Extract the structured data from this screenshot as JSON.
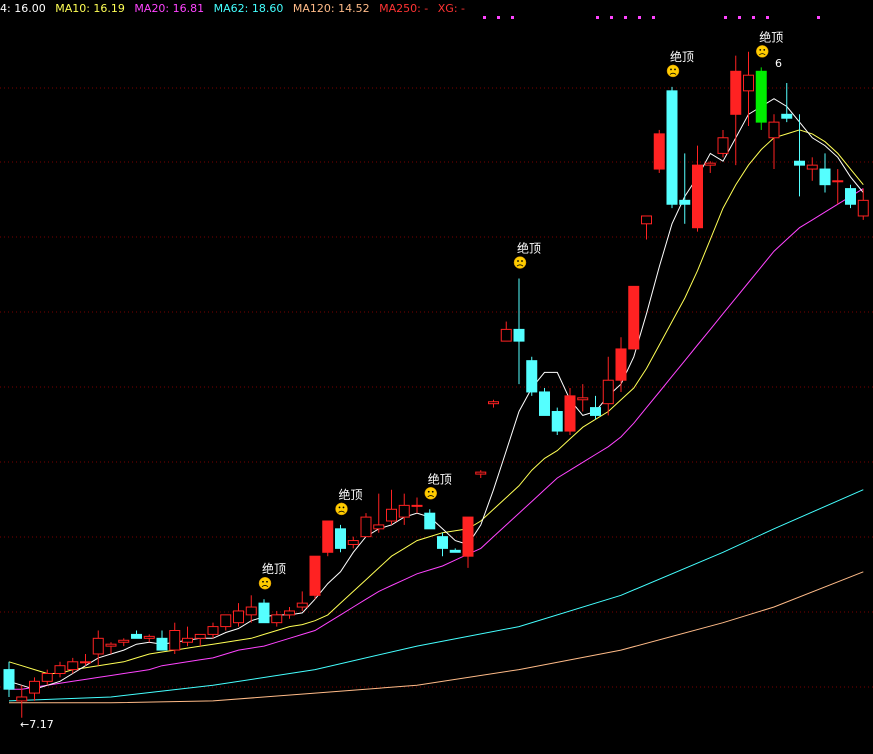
{
  "legend": [
    {
      "label": "4: 16.00",
      "color": "#ffffff"
    },
    {
      "label": "MA10: 16.19",
      "color": "#ffff55"
    },
    {
      "label": "MA20: 16.81",
      "color": "#ff44ff"
    },
    {
      "label": "MA62: 18.60",
      "color": "#44ffff"
    },
    {
      "label": "MA120: 14.52",
      "color": "#ffbb88"
    },
    {
      "label": "MA250: -",
      "color": "#ff3333"
    },
    {
      "label": "XG: -",
      "color": "#ff3333"
    }
  ],
  "colors": {
    "up": "#ff2222",
    "down": "#55ffff",
    "grid": "#7a0000",
    "signal": "#ff44ff",
    "strong": "#00ee00"
  },
  "chart_data": {
    "type": "candlestick",
    "price_range": [
      6.6,
      24.5
    ],
    "low_label": "7.17",
    "high_label": "6",
    "annotation_text": "绝顶",
    "candles": [
      {
        "o": 8.4,
        "h": 8.6,
        "l": 7.7,
        "c": 7.9,
        "d": 1
      },
      {
        "o": 7.7,
        "h": 8.0,
        "l": 7.17,
        "c": 7.6,
        "d": 0
      },
      {
        "o": 7.8,
        "h": 8.2,
        "l": 7.6,
        "c": 8.1,
        "d": 0
      },
      {
        "o": 8.1,
        "h": 8.4,
        "l": 8.0,
        "c": 8.3,
        "d": 0
      },
      {
        "o": 8.3,
        "h": 8.6,
        "l": 8.2,
        "c": 8.5,
        "d": 0
      },
      {
        "o": 8.4,
        "h": 8.7,
        "l": 8.3,
        "c": 8.6,
        "d": 0
      },
      {
        "o": 8.6,
        "h": 8.8,
        "l": 8.5,
        "c": 8.6,
        "d": 0
      },
      {
        "o": 8.8,
        "h": 9.4,
        "l": 8.5,
        "c": 9.2,
        "d": 0
      },
      {
        "o": 9.0,
        "h": 9.1,
        "l": 8.8,
        "c": 9.05,
        "d": 0
      },
      {
        "o": 9.1,
        "h": 9.2,
        "l": 9.0,
        "c": 9.15,
        "d": 0
      },
      {
        "o": 9.3,
        "h": 9.4,
        "l": 9.2,
        "c": 9.2,
        "d": 1
      },
      {
        "o": 9.2,
        "h": 9.3,
        "l": 9.1,
        "c": 9.25,
        "d": 0
      },
      {
        "o": 9.2,
        "h": 9.4,
        "l": 8.9,
        "c": 8.9,
        "d": 1
      },
      {
        "o": 8.9,
        "h": 9.6,
        "l": 8.8,
        "c": 9.4,
        "d": 0
      },
      {
        "o": 9.1,
        "h": 9.5,
        "l": 9.0,
        "c": 9.2,
        "d": 0
      },
      {
        "o": 9.2,
        "h": 9.3,
        "l": 9.0,
        "c": 9.3,
        "d": 0
      },
      {
        "o": 9.3,
        "h": 9.6,
        "l": 9.2,
        "c": 9.5,
        "d": 0
      },
      {
        "o": 9.5,
        "h": 9.8,
        "l": 9.4,
        "c": 9.8,
        "d": 0
      },
      {
        "o": 9.6,
        "h": 10.1,
        "l": 9.5,
        "c": 9.9,
        "d": 0
      },
      {
        "o": 9.8,
        "h": 10.3,
        "l": 9.6,
        "c": 10.0,
        "d": 0
      },
      {
        "o": 10.1,
        "h": 10.2,
        "l": 9.6,
        "c": 9.6,
        "d": 1,
        "sig": 1
      },
      {
        "o": 9.6,
        "h": 9.9,
        "l": 9.5,
        "c": 9.8,
        "d": 0
      },
      {
        "o": 9.8,
        "h": 10.0,
        "l": 9.7,
        "c": 9.9,
        "d": 0
      },
      {
        "o": 10.0,
        "h": 10.4,
        "l": 9.9,
        "c": 10.1,
        "d": 0
      },
      {
        "o": 10.3,
        "h": 11.3,
        "l": 10.2,
        "c": 11.3,
        "d": 0
      },
      {
        "o": 11.4,
        "h": 12.2,
        "l": 11.3,
        "c": 12.2,
        "d": 0
      },
      {
        "o": 12.0,
        "h": 12.1,
        "l": 11.4,
        "c": 11.5,
        "d": 1,
        "sig": 1
      },
      {
        "o": 11.6,
        "h": 11.8,
        "l": 11.5,
        "c": 11.7,
        "d": 0
      },
      {
        "o": 11.8,
        "h": 12.4,
        "l": 11.8,
        "c": 12.3,
        "d": 0
      },
      {
        "o": 12.0,
        "h": 12.9,
        "l": 11.9,
        "c": 12.1,
        "d": 0
      },
      {
        "o": 12.2,
        "h": 13.0,
        "l": 12.1,
        "c": 12.5,
        "d": 0
      },
      {
        "o": 12.3,
        "h": 12.9,
        "l": 12.1,
        "c": 12.6,
        "d": 0
      },
      {
        "o": 12.6,
        "h": 12.8,
        "l": 12.4,
        "c": 12.6,
        "d": 0
      },
      {
        "o": 12.4,
        "h": 12.5,
        "l": 12.0,
        "c": 12.0,
        "d": 1,
        "sig": 1
      },
      {
        "o": 11.8,
        "h": 11.9,
        "l": 11.3,
        "c": 11.5,
        "d": 1
      },
      {
        "o": 11.45,
        "h": 11.5,
        "l": 11.4,
        "c": 11.4,
        "d": 1
      },
      {
        "o": 11.3,
        "h": 12.3,
        "l": 11.0,
        "c": 12.3,
        "d": 0
      },
      {
        "o": 13.4,
        "h": 13.5,
        "l": 13.3,
        "c": 13.45,
        "d": 0
      },
      {
        "o": 15.2,
        "h": 15.3,
        "l": 15.1,
        "c": 15.25,
        "d": 0
      },
      {
        "o": 17.1,
        "h": 17.3,
        "l": 17.0,
        "c": 16.8,
        "d": 0
      },
      {
        "o": 16.8,
        "h": 18.4,
        "l": 15.7,
        "c": 17.1,
        "d": 1,
        "sig": 1
      },
      {
        "o": 16.3,
        "h": 16.4,
        "l": 15.4,
        "c": 15.5,
        "d": 1
      },
      {
        "o": 15.5,
        "h": 15.6,
        "l": 14.9,
        "c": 14.9,
        "d": 1
      },
      {
        "o": 15.0,
        "h": 15.1,
        "l": 14.4,
        "c": 14.5,
        "d": 1
      },
      {
        "o": 14.5,
        "h": 15.6,
        "l": 14.4,
        "c": 15.4,
        "d": 0
      },
      {
        "o": 15.3,
        "h": 15.7,
        "l": 15.0,
        "c": 15.35,
        "d": 0
      },
      {
        "o": 15.1,
        "h": 15.4,
        "l": 14.8,
        "c": 14.9,
        "d": 1
      },
      {
        "o": 15.2,
        "h": 16.4,
        "l": 14.9,
        "c": 15.8,
        "d": 0
      },
      {
        "o": 15.8,
        "h": 16.9,
        "l": 15.5,
        "c": 16.6,
        "d": 0
      },
      {
        "o": 16.6,
        "h": 18.2,
        "l": 16.6,
        "c": 18.2,
        "d": 0
      },
      {
        "o": 19.8,
        "h": 20.0,
        "l": 19.4,
        "c": 20.0,
        "d": 0
      },
      {
        "o": 21.2,
        "h": 22.2,
        "l": 21.1,
        "c": 22.1,
        "d": 0
      },
      {
        "o": 23.2,
        "h": 23.3,
        "l": 20.2,
        "c": 20.3,
        "d": 1,
        "sig": 1
      },
      {
        "o": 20.3,
        "h": 21.6,
        "l": 19.8,
        "c": 20.4,
        "d": 1
      },
      {
        "o": 19.7,
        "h": 21.8,
        "l": 19.6,
        "c": 21.3,
        "d": 0
      },
      {
        "o": 21.3,
        "h": 21.4,
        "l": 21.1,
        "c": 21.35,
        "d": 0
      },
      {
        "o": 21.6,
        "h": 22.2,
        "l": 21.5,
        "c": 22.0,
        "d": 0
      },
      {
        "o": 22.6,
        "h": 24.1,
        "l": 21.3,
        "c": 23.7,
        "d": 0
      },
      {
        "o": 23.2,
        "h": 24.2,
        "l": 22.3,
        "c": 23.6,
        "d": 0
      },
      {
        "o": 23.7,
        "h": 23.8,
        "l": 22.2,
        "c": 22.4,
        "d": 2,
        "sig": 1
      },
      {
        "o": 22.0,
        "h": 22.6,
        "l": 21.2,
        "c": 22.4,
        "d": 0
      },
      {
        "o": 22.6,
        "h": 23.4,
        "l": 22.4,
        "c": 22.5,
        "d": 1
      },
      {
        "o": 21.4,
        "h": 22.6,
        "l": 20.5,
        "c": 21.3,
        "d": 1
      },
      {
        "o": 21.3,
        "h": 21.5,
        "l": 20.9,
        "c": 21.2,
        "d": 0
      },
      {
        "o": 21.2,
        "h": 21.6,
        "l": 20.6,
        "c": 20.8,
        "d": 1
      },
      {
        "o": 20.9,
        "h": 21.2,
        "l": 20.3,
        "c": 20.9,
        "d": 0
      },
      {
        "o": 20.7,
        "h": 20.8,
        "l": 20.2,
        "c": 20.3,
        "d": 1
      },
      {
        "o": 20.0,
        "h": 20.7,
        "l": 19.9,
        "c": 20.4,
        "d": 0
      }
    ],
    "ma5": [
      8.1,
      8.0,
      7.9,
      8.0,
      8.1,
      8.3,
      8.5,
      8.7,
      8.8,
      8.9,
      9.05,
      9.1,
      9.05,
      9.1,
      9.15,
      9.2,
      9.2,
      9.35,
      9.45,
      9.65,
      9.75,
      9.8,
      9.8,
      9.85,
      10.2,
      10.6,
      10.9,
      11.4,
      11.8,
      12.0,
      12.1,
      12.3,
      12.4,
      12.3,
      12.0,
      11.7,
      11.6,
      12.1,
      13.0,
      14.0,
      15.0,
      15.6,
      16.0,
      16.0,
      15.3,
      14.9,
      15.0,
      15.4,
      15.7,
      16.4,
      17.5,
      18.7,
      19.8,
      20.5,
      21.0,
      21.6,
      21.4,
      22.0,
      22.6,
      22.8,
      23.0,
      22.8,
      22.4,
      22.0,
      21.8,
      21.5,
      21.0,
      20.6
    ],
    "ma10": [
      8.6,
      8.5,
      8.4,
      8.3,
      8.3,
      8.4,
      8.45,
      8.5,
      8.55,
      8.6,
      8.7,
      8.8,
      8.85,
      8.9,
      8.95,
      9.0,
      9.05,
      9.1,
      9.15,
      9.2,
      9.3,
      9.4,
      9.5,
      9.55,
      9.65,
      9.8,
      10.1,
      10.4,
      10.7,
      11.0,
      11.3,
      11.5,
      11.7,
      11.8,
      11.9,
      11.95,
      12.0,
      12.2,
      12.5,
      12.8,
      13.1,
      13.5,
      13.8,
      14.0,
      14.3,
      14.6,
      14.8,
      15.0,
      15.3,
      15.6,
      16.1,
      16.7,
      17.3,
      17.9,
      18.6,
      19.4,
      20.2,
      20.8,
      21.3,
      21.7,
      22.0,
      22.1,
      22.2,
      22.1,
      21.9,
      21.6,
      21.2,
      20.8
    ],
    "ma20": [
      7.9,
      7.9,
      7.95,
      8.0,
      8.05,
      8.1,
      8.15,
      8.2,
      8.25,
      8.3,
      8.35,
      8.4,
      8.5,
      8.55,
      8.6,
      8.65,
      8.7,
      8.8,
      8.9,
      8.95,
      9.0,
      9.1,
      9.2,
      9.3,
      9.4,
      9.6,
      9.8,
      10.0,
      10.2,
      10.4,
      10.55,
      10.7,
      10.85,
      10.95,
      11.05,
      11.2,
      11.35,
      11.5,
      11.8,
      12.1,
      12.4,
      12.7,
      13.0,
      13.3,
      13.5,
      13.7,
      13.9,
      14.1,
      14.35,
      14.7,
      15.1,
      15.5,
      15.9,
      16.3,
      16.7,
      17.1,
      17.5,
      17.9,
      18.3,
      18.7,
      19.1,
      19.4,
      19.7,
      19.9,
      20.1,
      20.3,
      20.5,
      20.7
    ]
  },
  "ma62_line": [
    [
      0,
      7.6
    ],
    [
      8,
      7.7
    ],
    [
      16,
      8.0
    ],
    [
      24,
      8.4
    ],
    [
      32,
      9.0
    ],
    [
      40,
      9.5
    ],
    [
      48,
      10.3
    ],
    [
      56,
      11.4
    ],
    [
      60,
      12.0
    ],
    [
      67,
      13.0
    ]
  ],
  "ma120_line": [
    [
      0,
      7.55
    ],
    [
      8,
      7.55
    ],
    [
      16,
      7.6
    ],
    [
      24,
      7.8
    ],
    [
      32,
      8.0
    ],
    [
      40,
      8.4
    ],
    [
      48,
      8.9
    ],
    [
      56,
      9.6
    ],
    [
      60,
      10.0
    ],
    [
      67,
      10.9
    ]
  ]
}
